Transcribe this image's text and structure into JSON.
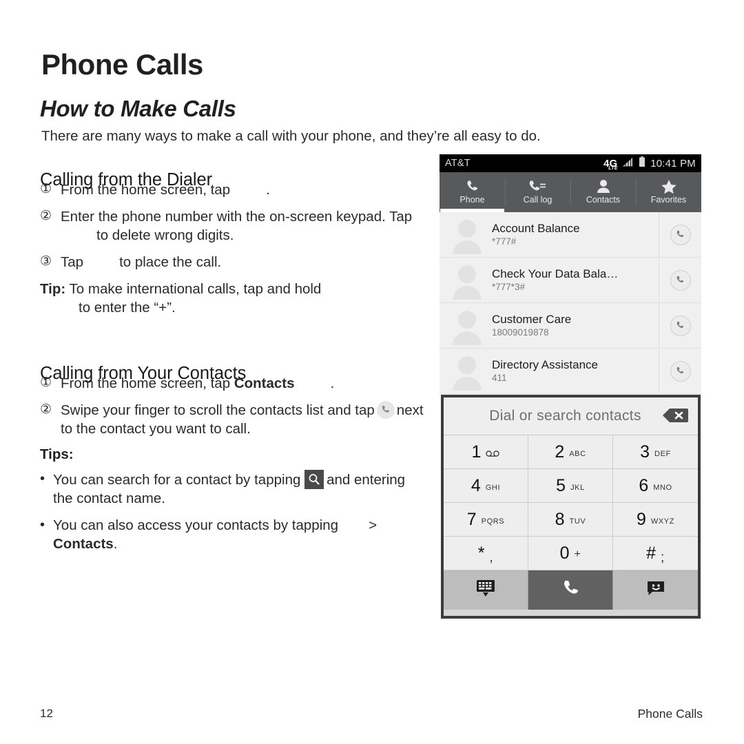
{
  "document": {
    "title": "Phone Calls",
    "section_title": "How to Make Calls",
    "intro": "There are many ways to make a call with your phone, and they’re all easy to do.",
    "footer": {
      "page_number": "12",
      "section": "Phone Calls"
    }
  },
  "dialer_section": {
    "heading": "Calling from the Dialer",
    "steps": [
      {
        "marker": "①",
        "before": "From the home screen, tap",
        "after": "."
      },
      {
        "marker": "②",
        "before": "Enter the phone number with the on-screen keypad. Tap",
        "after": "to delete wrong digits."
      },
      {
        "marker": "③",
        "before": "Tap",
        "after": "to place the call."
      }
    ],
    "tip_label": "Tip:",
    "tip_text": "To make international calls, tap and hold",
    "tip_text_cont": "to enter the “+”."
  },
  "contacts_section": {
    "heading": "Calling from Your Contacts",
    "step1": {
      "marker": "①",
      "before": "From the home screen, tap",
      "bold": "Contacts",
      "after": "."
    },
    "step2": {
      "marker": "②",
      "part1": "Swipe your finger to scroll the contacts list and tap",
      "part2": "next to the contact you want to call."
    },
    "tips_heading": "Tips:",
    "bullets": [
      {
        "marker": "•",
        "part1": "You can search for a contact by tapping",
        "part2": "and entering the contact name."
      },
      {
        "marker": "•",
        "part1": "You can also access your contacts by tapping",
        "part2": ">",
        "bold": "Contacts",
        "after": "."
      }
    ]
  },
  "phone_screenshot": {
    "status_bar": {
      "carrier": "AT&T",
      "network_badge": "4G",
      "network_sub": "LTE",
      "time": "10:41 PM",
      "icons": [
        "signal-icon",
        "battery-icon"
      ]
    },
    "tabs": [
      {
        "label": "Phone",
        "icon": "phone-handset-icon",
        "active": true
      },
      {
        "label": "Call log",
        "icon": "call-log-icon",
        "active": false
      },
      {
        "label": "Contacts",
        "icon": "person-icon",
        "active": false
      },
      {
        "label": "Favorites",
        "icon": "star-icon",
        "active": false
      }
    ],
    "contacts": [
      {
        "name": "Account Balance",
        "number": "*777#"
      },
      {
        "name": "Check Your Data Bala…",
        "number": "*777*3#"
      },
      {
        "name": "Customer Care",
        "number": "18009019878"
      },
      {
        "name": "Directory Assistance",
        "number": "411"
      }
    ]
  },
  "dialer_panel": {
    "input_placeholder": "Dial or search contacts",
    "backspace_icon": "backspace-icon",
    "keys": [
      {
        "digit": "1",
        "letters": "",
        "icon": "voicemail-icon"
      },
      {
        "digit": "2",
        "letters": "ABC",
        "icon": ""
      },
      {
        "digit": "3",
        "letters": "DEF",
        "icon": ""
      },
      {
        "digit": "4",
        "letters": "GHI",
        "icon": ""
      },
      {
        "digit": "5",
        "letters": "JKL",
        "icon": ""
      },
      {
        "digit": "6",
        "letters": "MNO",
        "icon": ""
      },
      {
        "digit": "7",
        "letters": "PQRS",
        "icon": ""
      },
      {
        "digit": "8",
        "letters": "TUV",
        "icon": ""
      },
      {
        "digit": "9",
        "letters": "WXYZ",
        "icon": ""
      },
      {
        "digit": "*",
        "letters": ",",
        "icon": ""
      },
      {
        "digit": "0",
        "letters": "+",
        "icon": ""
      },
      {
        "digit": "#",
        "letters": ";",
        "icon": ""
      }
    ],
    "actions": [
      {
        "name": "hide-keypad",
        "icon": "hide-keypad-icon"
      },
      {
        "name": "place-call",
        "icon": "phone-handset-icon"
      },
      {
        "name": "send-message",
        "icon": "message-smiley-icon"
      }
    ]
  },
  "colors": {
    "page_background": "#ffffff",
    "text": "#2b2b2b",
    "status_bar": "#000000",
    "tab_bar": "#58595b",
    "list_background": "#f0f0f0",
    "dialer_border": "#3c3c3c",
    "key_background": "#eeeeee",
    "call_key": "#616161",
    "action_key": "#bdbdbd"
  }
}
